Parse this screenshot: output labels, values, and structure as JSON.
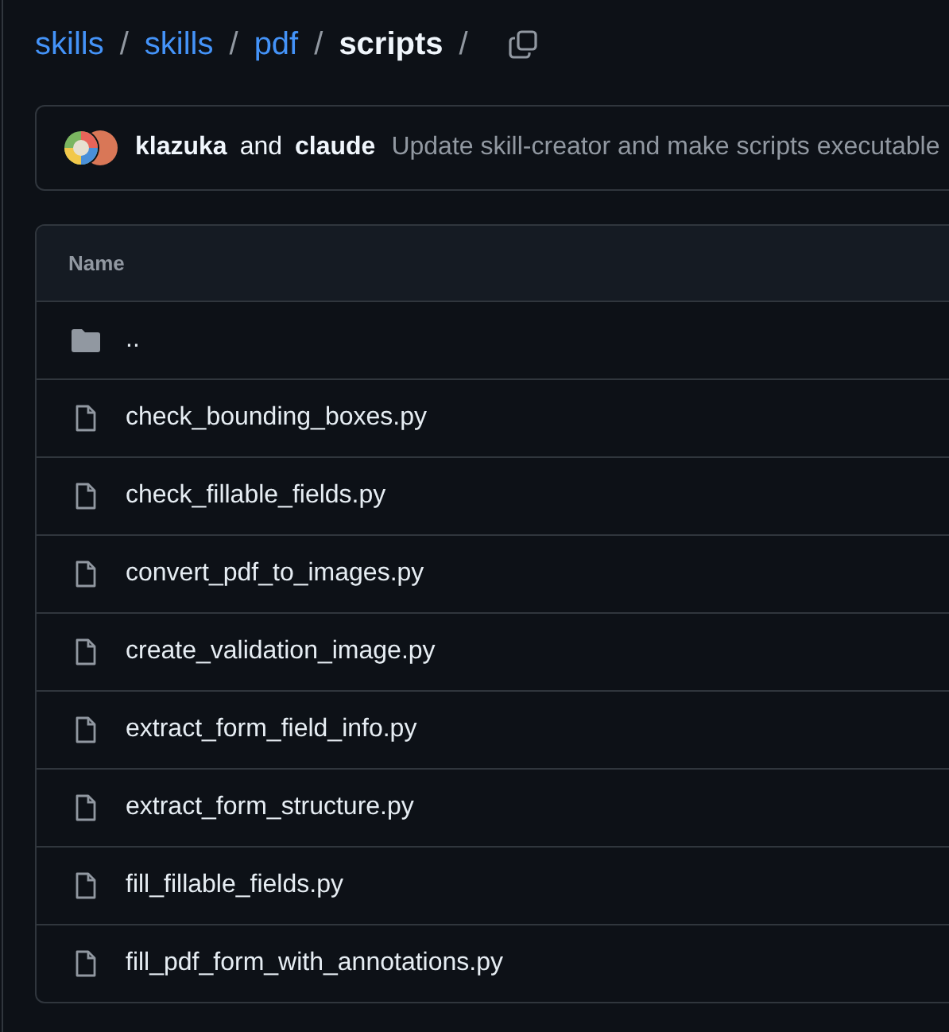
{
  "breadcrumb": [
    {
      "label": "skills",
      "current": false
    },
    {
      "label": "skills",
      "current": false
    },
    {
      "label": "pdf",
      "current": false
    },
    {
      "label": "scripts",
      "current": true
    }
  ],
  "breadcrumb_separator": "/",
  "commit": {
    "authors": [
      {
        "name": "klazuka"
      },
      {
        "name": "claude"
      }
    ],
    "joiner": "and",
    "message": "Update skill-creator and make scripts executable"
  },
  "table": {
    "columns": [
      "Name"
    ],
    "rows": [
      {
        "kind": "folder",
        "name": ".."
      },
      {
        "kind": "file",
        "name": "check_bounding_boxes.py"
      },
      {
        "kind": "file",
        "name": "check_fillable_fields.py"
      },
      {
        "kind": "file",
        "name": "convert_pdf_to_images.py"
      },
      {
        "kind": "file",
        "name": "create_validation_image.py"
      },
      {
        "kind": "file",
        "name": "extract_form_field_info.py"
      },
      {
        "kind": "file",
        "name": "extract_form_structure.py"
      },
      {
        "kind": "file",
        "name": "fill_fillable_fields.py"
      },
      {
        "kind": "file",
        "name": "fill_pdf_form_with_annotations.py"
      }
    ]
  }
}
